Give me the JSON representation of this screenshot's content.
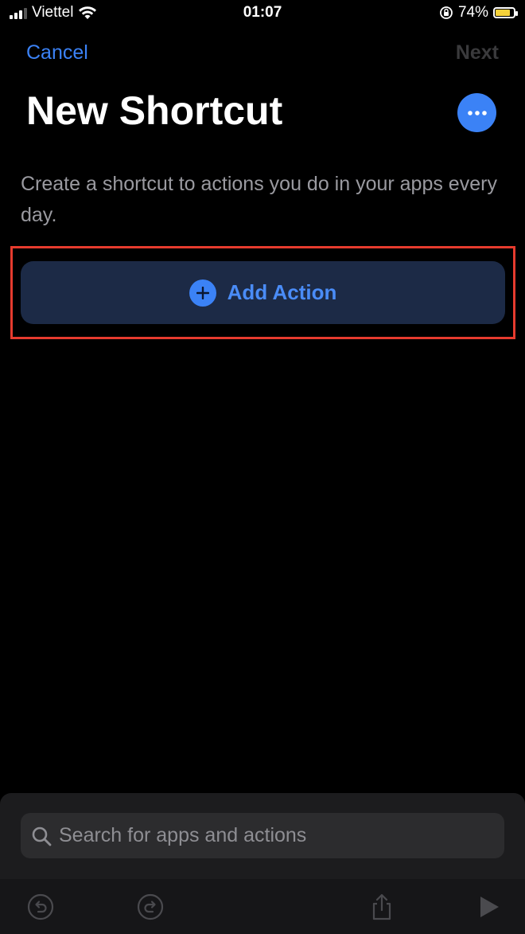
{
  "status_bar": {
    "carrier": "Viettel",
    "time": "01:07",
    "battery": "74%",
    "battery_level": 0.74
  },
  "nav": {
    "cancel": "Cancel",
    "next": "Next"
  },
  "title": "New Shortcut",
  "description": "Create a shortcut to actions you do in your apps every day.",
  "add_action": {
    "label": "Add Action"
  },
  "search": {
    "placeholder": "Search for apps and actions",
    "value": ""
  },
  "icons": {
    "more": "ellipsis-icon",
    "add": "plus-circle-icon",
    "search": "magnifier-icon",
    "undo": "undo-icon",
    "redo": "redo-icon",
    "share": "share-icon",
    "play": "play-icon"
  },
  "colors": {
    "accent": "#3b82f6",
    "highlight": "#e63b2e",
    "add_action_bg": "#1c2a46"
  }
}
